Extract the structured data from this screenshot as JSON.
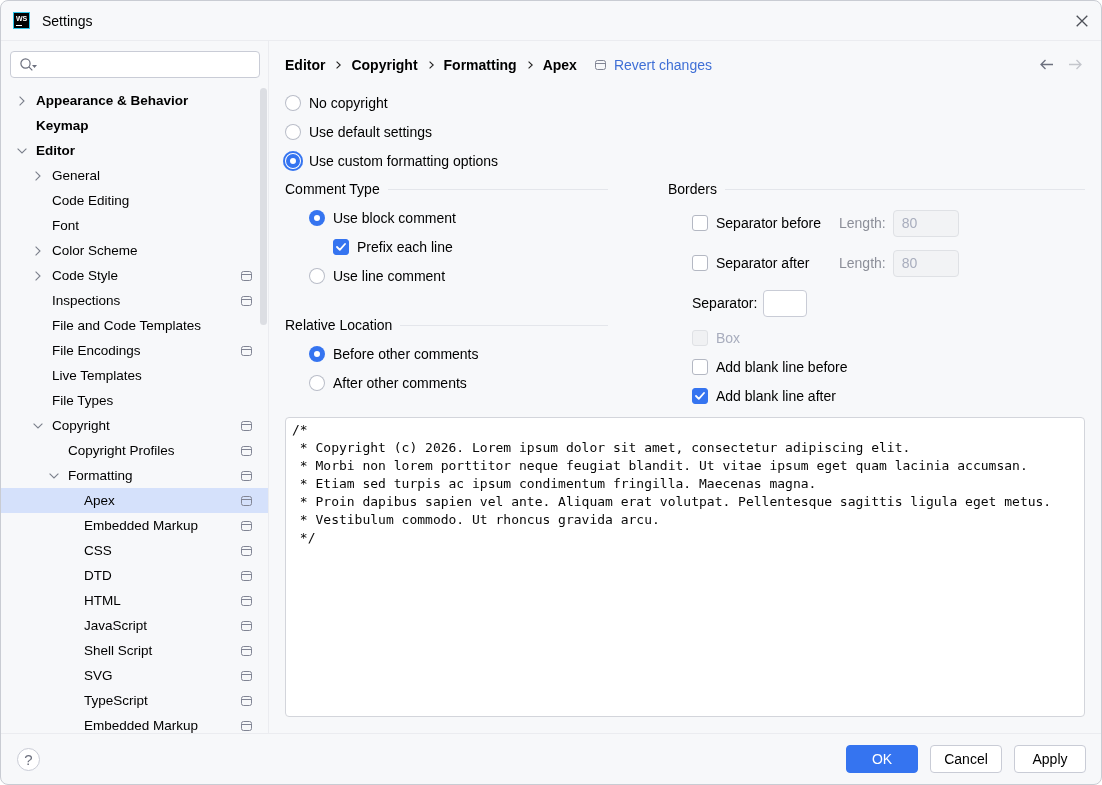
{
  "window": {
    "title": "Settings",
    "logo_text": "WS"
  },
  "sidebar": {
    "tree": [
      {
        "label": "Appearance & Behavior",
        "expanded": false,
        "selected": false,
        "project_level": false
      },
      {
        "label": "Keymap",
        "selected": false,
        "project_level": false
      },
      {
        "label": "Editor",
        "expanded": true,
        "selected": false,
        "project_level": false,
        "children": [
          {
            "label": "General",
            "expanded": false,
            "selected": false,
            "project_level": false
          },
          {
            "label": "Code Editing",
            "selected": false,
            "project_level": false
          },
          {
            "label": "Font",
            "selected": false,
            "project_level": false
          },
          {
            "label": "Color Scheme",
            "expanded": false,
            "selected": false,
            "project_level": false
          },
          {
            "label": "Code Style",
            "expanded": false,
            "selected": false,
            "project_level": true
          },
          {
            "label": "Inspections",
            "selected": false,
            "project_level": true
          },
          {
            "label": "File and Code Templates",
            "selected": false,
            "project_level": false
          },
          {
            "label": "File Encodings",
            "selected": false,
            "project_level": true
          },
          {
            "label": "Live Templates",
            "selected": false,
            "project_level": false
          },
          {
            "label": "File Types",
            "selected": false,
            "project_level": false
          },
          {
            "label": "Copyright",
            "expanded": true,
            "selected": false,
            "project_level": true,
            "children": [
              {
                "label": "Copyright Profiles",
                "selected": false,
                "project_level": true
              },
              {
                "label": "Formatting",
                "expanded": true,
                "selected": false,
                "project_level": true,
                "children": [
                  {
                    "label": "Apex",
                    "selected": true,
                    "project_level": true
                  },
                  {
                    "label": "Embedded Markup",
                    "selected": false,
                    "project_level": true
                  },
                  {
                    "label": "CSS",
                    "selected": false,
                    "project_level": true
                  },
                  {
                    "label": "DTD",
                    "selected": false,
                    "project_level": true
                  },
                  {
                    "label": "HTML",
                    "selected": false,
                    "project_level": true
                  },
                  {
                    "label": "JavaScript",
                    "selected": false,
                    "project_level": true
                  },
                  {
                    "label": "Shell Script",
                    "selected": false,
                    "project_level": true
                  },
                  {
                    "label": "SVG",
                    "selected": false,
                    "project_level": true
                  },
                  {
                    "label": "TypeScript",
                    "selected": false,
                    "project_level": true
                  },
                  {
                    "label": "Embedded Markup",
                    "selected": false,
                    "project_level": true
                  }
                ]
              }
            ]
          }
        ]
      }
    ]
  },
  "breadcrumb": [
    "Editor",
    "Copyright",
    "Formatting",
    "Apex"
  ],
  "revert_link": "Revert changes",
  "navigation": [
    {
      "kind": "back",
      "disabled": false
    },
    {
      "kind": "forward",
      "disabled": true
    }
  ],
  "copyright_options": [
    {
      "label": "No copyright",
      "selected": false,
      "focused": false
    },
    {
      "label": "Use default settings",
      "selected": false,
      "focused": false
    },
    {
      "label": "Use custom formatting options",
      "selected": true,
      "focused": true
    }
  ],
  "comment_type": {
    "title": "Comment Type",
    "options": [
      {
        "kind": "radio",
        "label": "Use block comment",
        "selected": true,
        "children": [
          {
            "kind": "checkbox",
            "label": "Prefix each line",
            "checked": true
          }
        ]
      },
      {
        "kind": "radio",
        "label": "Use line comment",
        "selected": false
      }
    ]
  },
  "relative_location": {
    "title": "Relative Location",
    "options": [
      {
        "kind": "radio",
        "label": "Before other comments",
        "selected": true
      },
      {
        "kind": "radio",
        "label": "After other comments",
        "selected": false
      }
    ]
  },
  "borders": {
    "title": "Borders",
    "items": [
      {
        "kind": "separator_check",
        "label": "Separator before",
        "checked": false,
        "disabled": false,
        "length": {
          "label": "Length:",
          "value": "80",
          "disabled": true
        }
      },
      {
        "kind": "separator_check",
        "label": "Separator after",
        "checked": false,
        "disabled": false,
        "length": {
          "label": "Length:",
          "value": "80",
          "disabled": true
        }
      },
      {
        "kind": "separator_field",
        "label": "Separator:"
      },
      {
        "kind": "checkbox",
        "label": "Box",
        "checked": false,
        "disabled": true
      },
      {
        "kind": "checkbox",
        "label": "Add blank line before",
        "checked": false,
        "disabled": false
      },
      {
        "kind": "checkbox",
        "label": "Add blank line after",
        "checked": true,
        "disabled": false
      }
    ]
  },
  "preview": {
    "lines": [
      "/*",
      " * Copyright (c) 2026. Lorem ipsum dolor sit amet, consectetur adipiscing elit.",
      " * Morbi non lorem porttitor neque feugiat blandit. Ut vitae ipsum eget quam lacinia accumsan.",
      " * Etiam sed turpis ac ipsum condimentum fringilla. Maecenas magna.",
      " * Proin dapibus sapien vel ante. Aliquam erat volutpat. Pellentesque sagittis ligula eget metus.",
      " * Vestibulum commodo. Ut rhoncus gravida arcu.",
      " */"
    ]
  },
  "footer": {
    "help": "?",
    "buttons": [
      {
        "label": "OK",
        "kind": "primary"
      },
      {
        "label": "Cancel",
        "kind": "secondary"
      },
      {
        "label": "Apply",
        "kind": "secondary"
      }
    ]
  }
}
